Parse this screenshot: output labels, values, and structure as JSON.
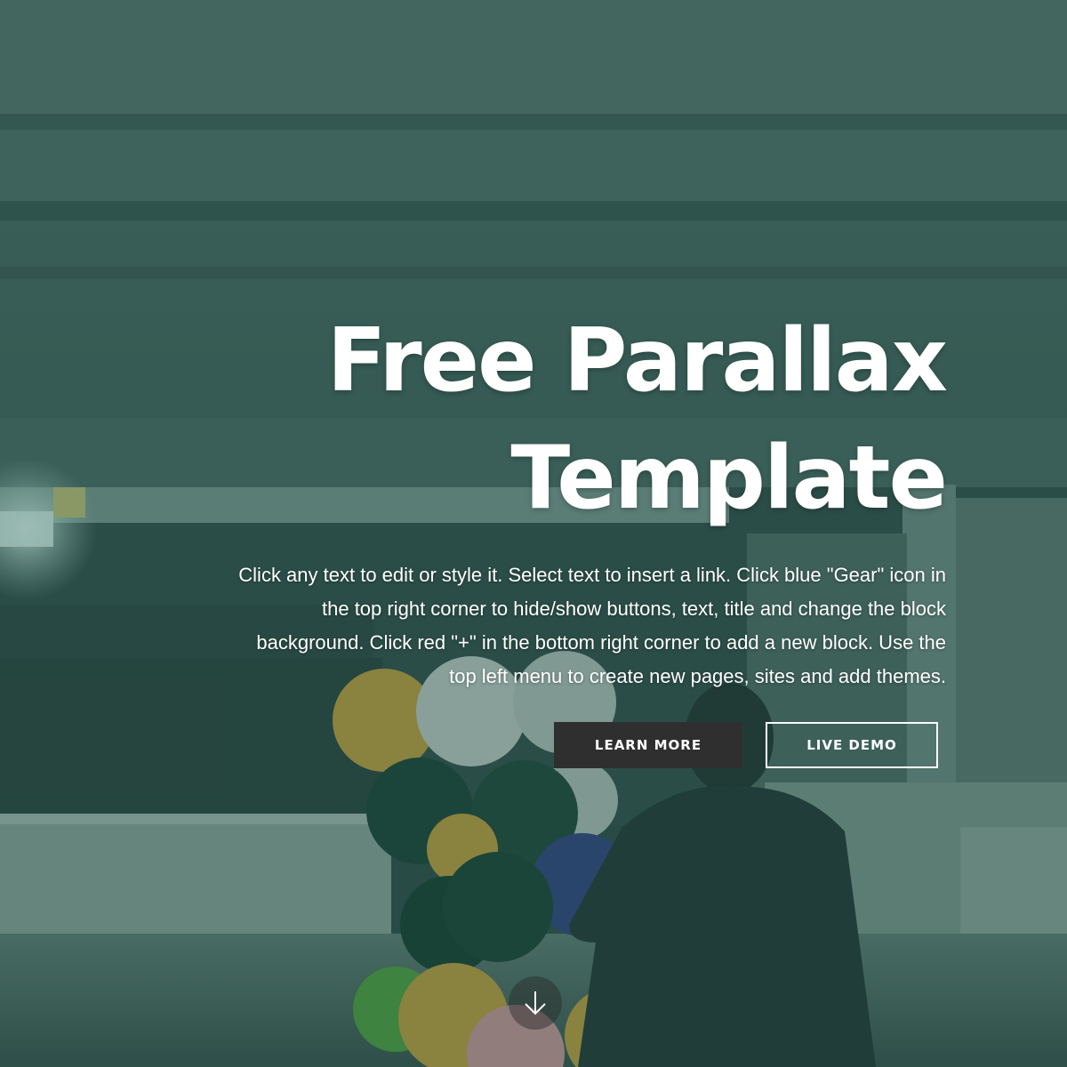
{
  "hero": {
    "title_line1": "Free Parallax",
    "title_line2": "Template",
    "description_line1": "Click any text to edit or style it. Select text to insert a link. Click blue \"Gear\" icon in",
    "description_line2": "the top right corner to hide/show buttons, text, title and change the block",
    "description_line3": "background. Click red \"+\" in the bottom right corner to add a new block. Use the",
    "description_line4": "top left menu to create new pages, sites and add themes.",
    "primary_button_label": "LEARN MORE",
    "secondary_button_label": "LIVE DEMO",
    "scroll_icon": "arrow-down-icon"
  },
  "colors": {
    "overlay": "#264e46",
    "primary_button_bg": "#2f2f2f",
    "text": "#ffffff"
  }
}
